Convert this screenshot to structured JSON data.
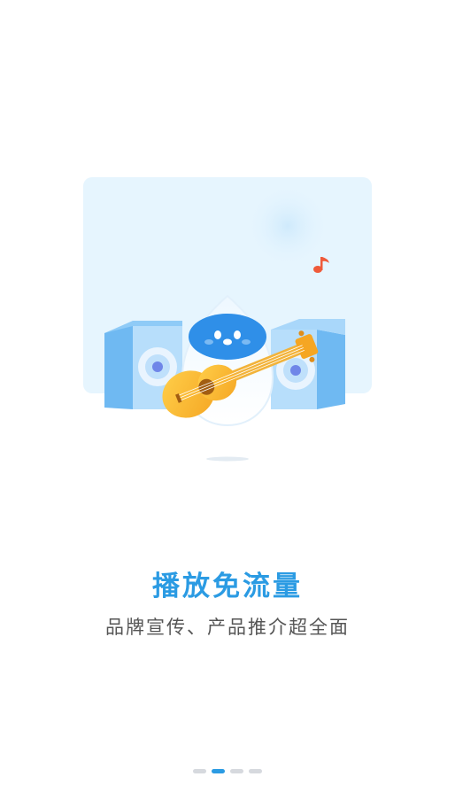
{
  "onboarding": {
    "title": "播放免流量",
    "subtitle": "品牌宣传、产品推介超全面",
    "page_count": 4,
    "active_page": 2
  },
  "illustration": {
    "depicts": [
      "speaker-left",
      "speaker-right",
      "water-drop-mascot",
      "ukulele",
      "music-note"
    ]
  },
  "colors": {
    "accent": "#2b9be3",
    "panel": "#e6f5fe",
    "note": "#ef5a3a",
    "dot_inactive": "#d6d9de"
  }
}
